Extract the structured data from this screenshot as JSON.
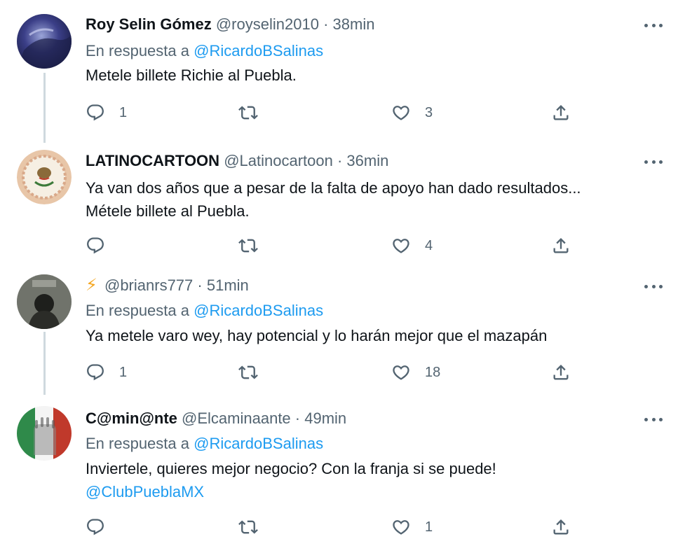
{
  "tweets": [
    {
      "name": "Roy Selin Gómez",
      "handle": "@royselin2010",
      "separator": "·",
      "time": "38min",
      "reply_prefix": "En respuesta a",
      "reply_handle": "@RicardoBSalinas",
      "text_line1": "Metele billete Richie al Puebla.",
      "replies": "1",
      "retweets": "",
      "likes": "3"
    },
    {
      "name": "LATINOCARTOON",
      "handle": "@Latinocartoon",
      "separator": "·",
      "time": "36min",
      "text_line1": "Ya van dos años que a pesar de la falta de apoyo han dado resultados...",
      "text_line2": "Métele billete al Puebla.",
      "replies": "",
      "retweets": "",
      "likes": "4"
    },
    {
      "name": "⚡",
      "handle": "@brianrs777",
      "separator": "·",
      "time": "51min",
      "reply_prefix": "En respuesta a",
      "reply_handle": "@RicardoBSalinas",
      "text_line1": "Ya metele varo wey, hay potencial y lo harán mejor que el mazapán",
      "replies": "1",
      "retweets": "",
      "likes": "18"
    },
    {
      "name": "C@min@nte",
      "handle": "@Elcaminaante",
      "separator": "·",
      "time": "49min",
      "reply_prefix": "En respuesta a",
      "reply_handle": "@RicardoBSalinas",
      "text_line1": "Inviertele, quieres mejor negocio? Con la franja si se puede!",
      "text_mention": "@ClubPueblaMX",
      "replies": "",
      "retweets": "",
      "likes": "1"
    }
  ],
  "colors": {
    "text": "#0f1419",
    "secondary": "#536471",
    "link": "#1d9bf0",
    "thread_line": "#cfd9de",
    "bolt": "#f4a620"
  },
  "icons": [
    "reply-icon",
    "retweet-icon",
    "like-icon",
    "share-icon",
    "more-icon"
  ]
}
